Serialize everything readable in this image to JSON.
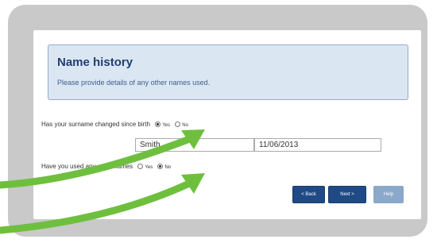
{
  "form": {
    "title": "Name history",
    "subtitle": "Please provide details of any other names used.",
    "q1": {
      "label": "Has your surname changed since birth",
      "yes": "Yes",
      "no": "No",
      "selected": "Yes"
    },
    "name_value": "Smith",
    "date_value": "11/06/2013",
    "q2": {
      "label": "Have you used any other names",
      "yes": "Yes",
      "no": "No",
      "selected": "No"
    },
    "buttons": {
      "back": "< Back",
      "next": "Next >",
      "help": "Help"
    }
  },
  "colors": {
    "header_bg": "#dbe6f3",
    "title": "#21406e",
    "button": "#1f4a86",
    "button_disabled": "#8aa8ca",
    "arrow": "#6fbf3f",
    "frame": "#c9c9c9"
  }
}
